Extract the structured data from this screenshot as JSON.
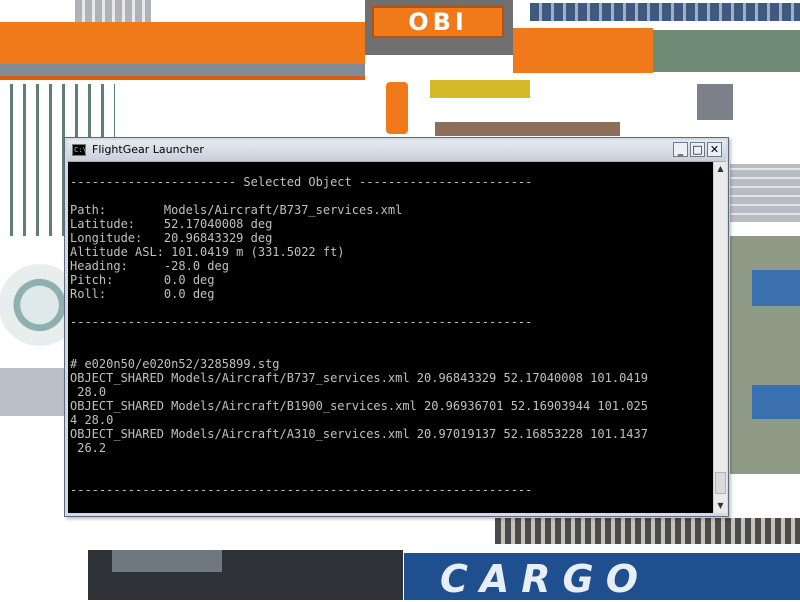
{
  "window": {
    "title": "FlightGear Launcher",
    "icon": "cmd-icon",
    "controls": {
      "minimize": "_",
      "maximize": "□",
      "close": "✕"
    }
  },
  "console": {
    "lines": [
      "----------------------- Selected Object ------------------------",
      "",
      "Path:        Models/Aircraft/B737_services.xml",
      "Latitude:    52.17040008 deg",
      "Longitude:   20.96843329 deg",
      "Altitude ASL: 101.0419 m (331.5022 ft)",
      "Heading:     -28.0 deg",
      "Pitch:       0.0 deg",
      "Roll:        0.0 deg",
      "",
      "----------------------------------------------------------------",
      "",
      "",
      "# e020n50/e020n52/3285899.stg",
      "OBJECT_SHARED Models/Aircraft/B737_services.xml 20.96843329 52.17040008 101.0419",
      " 28.0",
      "OBJECT_SHARED Models/Aircraft/B1900_services.xml 20.96936701 52.16903944 101.025",
      "4 28.0",
      "OBJECT_SHARED Models/Aircraft/A310_services.xml 20.97019137 52.16853228 101.1437",
      " 26.2",
      "",
      "",
      "----------------------------------------------------------------"
    ]
  },
  "scrollbar": {
    "up": "▲",
    "down": "▼"
  },
  "background": {
    "store_sign": "OBI",
    "cargo_sign": "CARGO",
    "colors": {
      "obi_orange": "#f07a1a",
      "cargo_blue": "#1f4f8f",
      "roof_blue": "#3a6fb0"
    }
  }
}
